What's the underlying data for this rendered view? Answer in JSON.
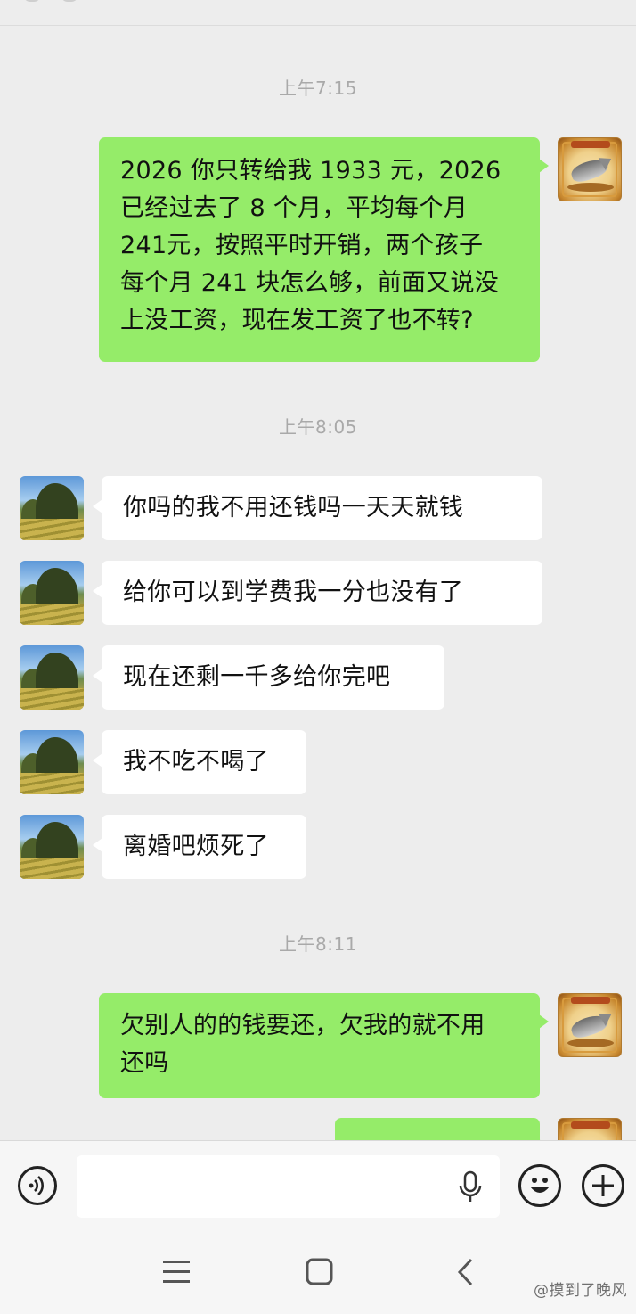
{
  "chat": {
    "timestamps": [
      "上午7:15",
      "上午8:05",
      "上午8:11"
    ],
    "messages": [
      {
        "side": "out",
        "lines": [
          "2026 你只转给我 1933 元，2026",
          "已经过去了 8 个月，平均每个月",
          "241元，按照平时开销，两个孩子",
          "每个月 241 块怎么够，前面又说没",
          "上没工资，现在发工资了也不转?"
        ]
      },
      {
        "side": "in",
        "text": "你吗的我不用还钱吗一天天就钱"
      },
      {
        "side": "in",
        "text": "给你可以到学费我一分也没有了"
      },
      {
        "side": "in",
        "text": "现在还剩一千多给你完吧"
      },
      {
        "side": "in",
        "text": "我不吃不喝了"
      },
      {
        "side": "in",
        "text": "离婚吧烦死了"
      },
      {
        "side": "out",
        "lines": [
          "欠别人的的钱要还，欠我的就不用",
          "还吗"
        ]
      },
      {
        "side": "out",
        "text": ""
      }
    ]
  },
  "input": {
    "voice_icon": "voice-toggle-icon",
    "mic_icon": "microphone-icon",
    "emoji_icon": "emoji-icon",
    "plus_icon": "plus-icon"
  },
  "nav": {
    "menu_icon": "menu-icon",
    "home_icon": "home-square-icon",
    "back_icon": "back-chevron-icon"
  },
  "watermark": "@摸到了晚风",
  "colors": {
    "background": "#ededed",
    "outgoing_bubble": "#95ec69",
    "incoming_bubble": "#ffffff",
    "timestamp": "#a9a9a9"
  }
}
